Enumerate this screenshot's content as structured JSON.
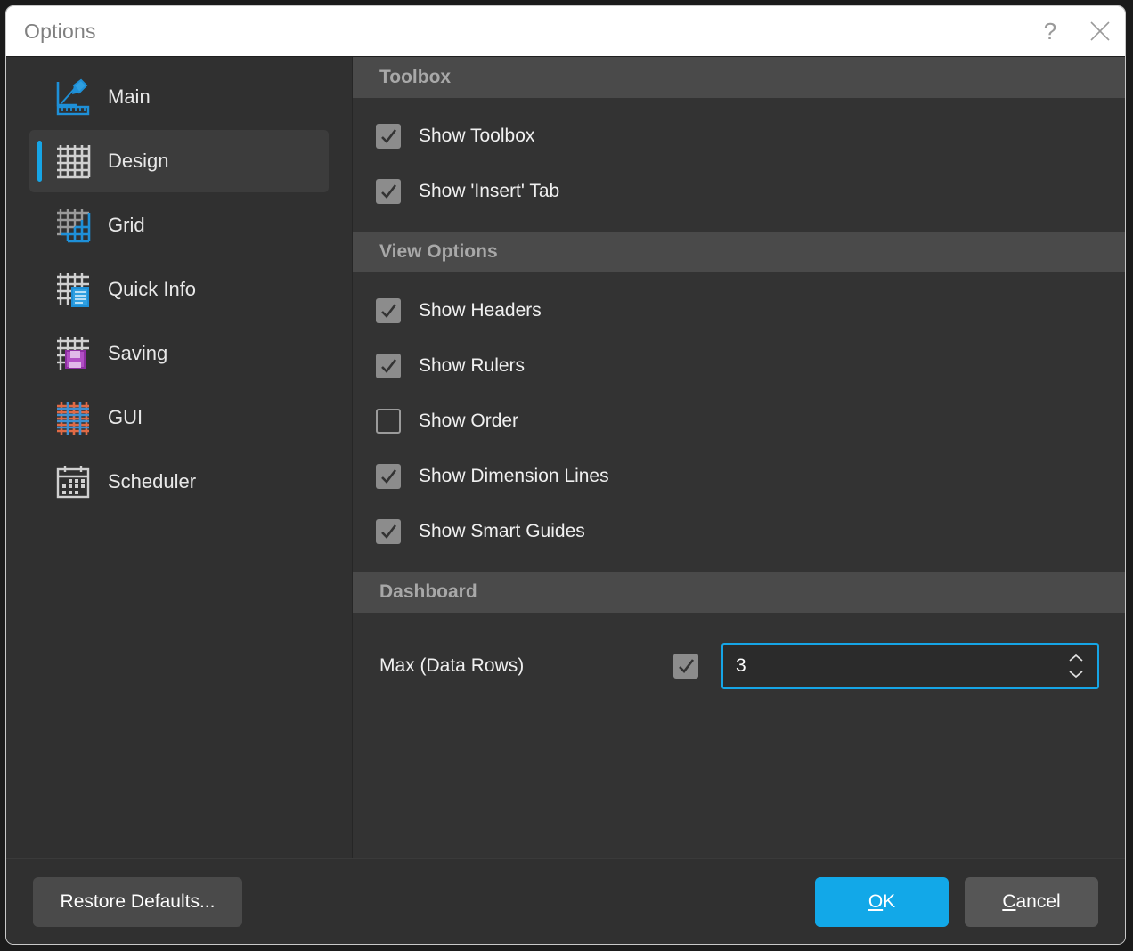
{
  "window": {
    "title": "Options",
    "help_icon": "question-mark-icon",
    "close_icon": "close-icon"
  },
  "sidebar": {
    "items": [
      {
        "label": "Main",
        "icon": "pencil-ruler-icon",
        "selected": false
      },
      {
        "label": "Design",
        "icon": "grid-icon",
        "selected": true
      },
      {
        "label": "Grid",
        "icon": "grid-subgrid-icon",
        "selected": false
      },
      {
        "label": "Quick Info",
        "icon": "grid-document-icon",
        "selected": false
      },
      {
        "label": "Saving",
        "icon": "grid-floppy-icon",
        "selected": false
      },
      {
        "label": "GUI",
        "icon": "crosshatch-grid-icon",
        "selected": false
      },
      {
        "label": "Scheduler",
        "icon": "calendar-icon",
        "selected": false
      }
    ]
  },
  "content": {
    "sections": [
      {
        "title": "Toolbox",
        "checkboxes": [
          {
            "label": "Show Toolbox",
            "checked": true
          },
          {
            "label": "Show 'Insert' Tab",
            "checked": true
          }
        ]
      },
      {
        "title": "View Options",
        "checkboxes": [
          {
            "label": "Show Headers",
            "checked": true
          },
          {
            "label": "Show Rulers",
            "checked": true
          },
          {
            "label": "Show Order",
            "checked": false
          },
          {
            "label": "Show Dimension Lines",
            "checked": true
          },
          {
            "label": "Show Smart Guides",
            "checked": true
          }
        ]
      }
    ],
    "dashboard": {
      "title": "Dashboard",
      "max_data_rows": {
        "label": "Max (Data Rows)",
        "enabled": true,
        "value": "3",
        "up_icon": "chevron-up-icon",
        "down_icon": "chevron-down-icon"
      }
    }
  },
  "footer": {
    "restore_label": "Restore Defaults...",
    "ok_label_mnemonic": "O",
    "ok_label_rest": "K",
    "cancel_label_mnemonic": "C",
    "cancel_label_rest": "ancel"
  },
  "colors": {
    "accent": "#12a8e8",
    "sidebar_bg": "#303030",
    "content_bg": "#333333",
    "section_header_bg": "#4a4a4a",
    "titlebar_bg": "#ffffff"
  }
}
